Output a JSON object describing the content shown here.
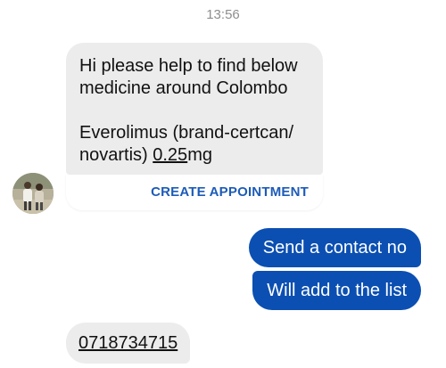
{
  "timestamp": "13:56",
  "incoming_message": {
    "line1": "Hi please help to find below",
    "line2": "medicine around Colombo",
    "line3": "Everolimus (brand-certcan/",
    "line4_prefix": "novartis) ",
    "line4_dose": "0.25",
    "line4_unit": "mg",
    "action_label": "CREATE APPOINTMENT"
  },
  "outgoing_messages": [
    {
      "text": "Send a contact no"
    },
    {
      "text": "Will add to the list"
    }
  ],
  "incoming_phone": {
    "text": "0718734715"
  },
  "colors": {
    "outgoing_bubble": "#0b4fb2",
    "incoming_bubble": "#ececec",
    "action_text": "#1d5bb8",
    "timestamp_text": "#8e8e8e"
  }
}
